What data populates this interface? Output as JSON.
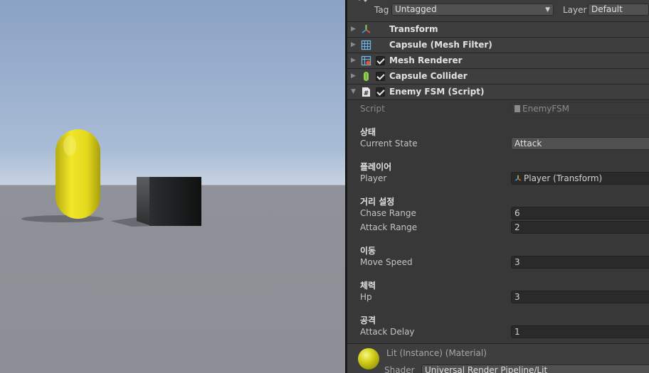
{
  "header": {
    "tag_label": "Tag",
    "tag_value": "Untagged",
    "layer_label": "Layer",
    "layer_value": "Default"
  },
  "components": [
    {
      "name": "Transform",
      "icon": "transform-axes-icon",
      "has_checkbox": false,
      "checked": false,
      "expanded": false
    },
    {
      "name": "Capsule (Mesh Filter)",
      "icon": "mesh-filter-grid-icon",
      "has_checkbox": false,
      "checked": false,
      "expanded": false
    },
    {
      "name": "Mesh Renderer",
      "icon": "mesh-renderer-icon",
      "has_checkbox": true,
      "checked": true,
      "expanded": false
    },
    {
      "name": "Capsule Collider",
      "icon": "capsule-collider-icon",
      "has_checkbox": true,
      "checked": true,
      "expanded": false
    },
    {
      "name": "Enemy FSM (Script)",
      "icon": "csharp-script-icon",
      "has_checkbox": true,
      "checked": true,
      "expanded": true
    }
  ],
  "script": {
    "script_label": "Script",
    "script_value": "EnemyFSM",
    "sections": [
      {
        "header": "상태",
        "fields": [
          {
            "label": "Current State",
            "value": "Attack",
            "type": "dropdown"
          }
        ]
      },
      {
        "header": "플레이어",
        "fields": [
          {
            "label": "Player",
            "value": "Player (Transform)",
            "type": "object"
          }
        ]
      },
      {
        "header": "거리 설정",
        "fields": [
          {
            "label": "Chase Range",
            "value": "6",
            "type": "number"
          },
          {
            "label": "Attack Range",
            "value": "2",
            "type": "number"
          }
        ]
      },
      {
        "header": "이동",
        "fields": [
          {
            "label": "Move Speed",
            "value": "3",
            "type": "number"
          }
        ]
      },
      {
        "header": "체력",
        "fields": [
          {
            "label": "Hp",
            "value": "3",
            "type": "number"
          }
        ]
      },
      {
        "header": "공격",
        "fields": [
          {
            "label": "Attack Delay",
            "value": "1",
            "type": "number"
          }
        ]
      }
    ]
  },
  "material": {
    "name": "Lit (Instance) (Material)",
    "shader_label": "Shader",
    "shader_value": "Universal Render Pipeline/Lit"
  },
  "colors": {
    "capsule": "#e3d91c",
    "cube": "#1f2222",
    "sky": "#a9bcd6",
    "ground": "#8f9298",
    "panel": "#383838"
  }
}
